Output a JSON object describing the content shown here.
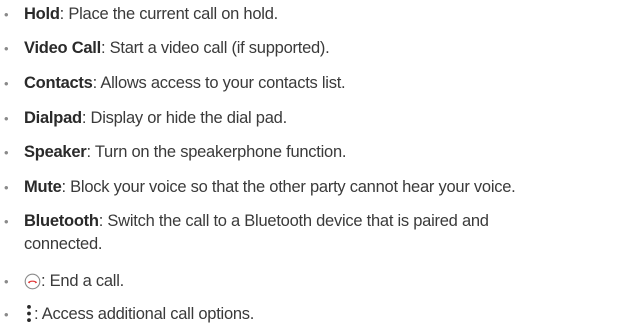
{
  "items": [
    {
      "term": "Hold",
      "desc": ": Place the current call on hold."
    },
    {
      "term": "Video Call",
      "desc": ": Start a video call (if supported)."
    },
    {
      "term": "Contacts",
      "desc": ": Allows access to your contacts list."
    },
    {
      "term": "Dialpad",
      "desc": ": Display or hide the dial pad."
    },
    {
      "term": "Speaker",
      "desc": ": Turn on the speakerphone function."
    },
    {
      "term": "Mute",
      "desc": ": Block your voice so that the other party cannot hear your voice."
    },
    {
      "term": "Bluetooth",
      "desc": ": Switch the call to a Bluetooth device that is paired and",
      "desc_cont": "connected."
    },
    {
      "icon": "end-call-icon",
      "desc": ": End a call."
    },
    {
      "icon": "more-options-icon",
      "desc": ": Access additional call options."
    }
  ],
  "colors": {
    "bullet": "#8a8a8a",
    "end_call_accent": "#e03a3a",
    "text": "#3a3a3a"
  }
}
